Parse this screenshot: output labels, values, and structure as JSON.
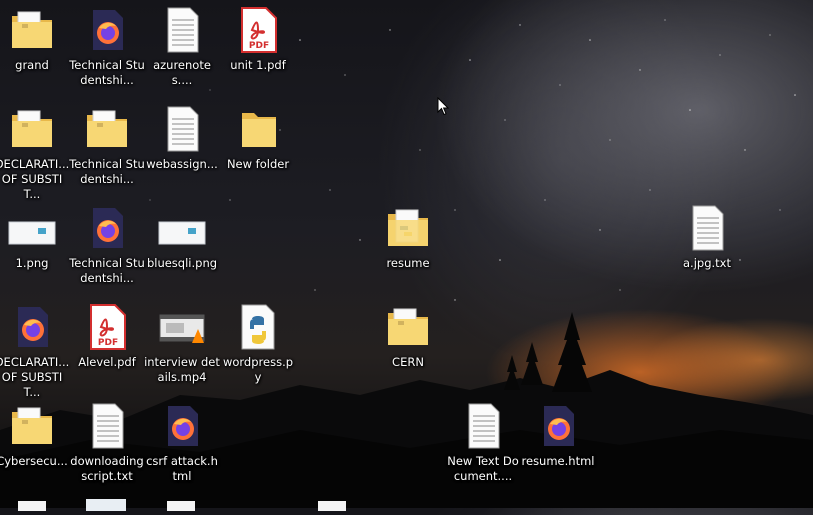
{
  "desktop": {
    "icons": [
      {
        "label": "grand",
        "type": "folder"
      },
      {
        "label": "Technical Studentshi...",
        "type": "firefox"
      },
      {
        "label": "azurenotes....",
        "type": "text"
      },
      {
        "label": "unit 1.pdf",
        "type": "pdf"
      },
      {
        "label": "DECLARATI... OF SUBSTIT...",
        "type": "folder"
      },
      {
        "label": "Technical Studentshi...",
        "type": "folder"
      },
      {
        "label": "webassign...",
        "type": "text"
      },
      {
        "label": "New folder",
        "type": "folder-empty"
      },
      {
        "label": "1.png",
        "type": "image"
      },
      {
        "label": "Technical Studentshi...",
        "type": "firefox"
      },
      {
        "label": "bluesqli.png",
        "type": "image"
      },
      {
        "label": "resume",
        "type": "folder-python"
      },
      {
        "label": "a.jpg.txt",
        "type": "text"
      },
      {
        "label": "DECLARATI... OF SUBSTIT...",
        "type": "firefox"
      },
      {
        "label": "Alevel.pdf",
        "type": "pdf"
      },
      {
        "label": "interview details.mp4",
        "type": "video"
      },
      {
        "label": "wordpress.py",
        "type": "python"
      },
      {
        "label": "CERN",
        "type": "folder"
      },
      {
        "label": "Cybersecu...",
        "type": "folder"
      },
      {
        "label": "downloading script.txt",
        "type": "text"
      },
      {
        "label": "csrf attack.html",
        "type": "firefox"
      },
      {
        "label": "New Text Document....",
        "type": "text"
      },
      {
        "label": "resume.html",
        "type": "firefox"
      }
    ]
  }
}
